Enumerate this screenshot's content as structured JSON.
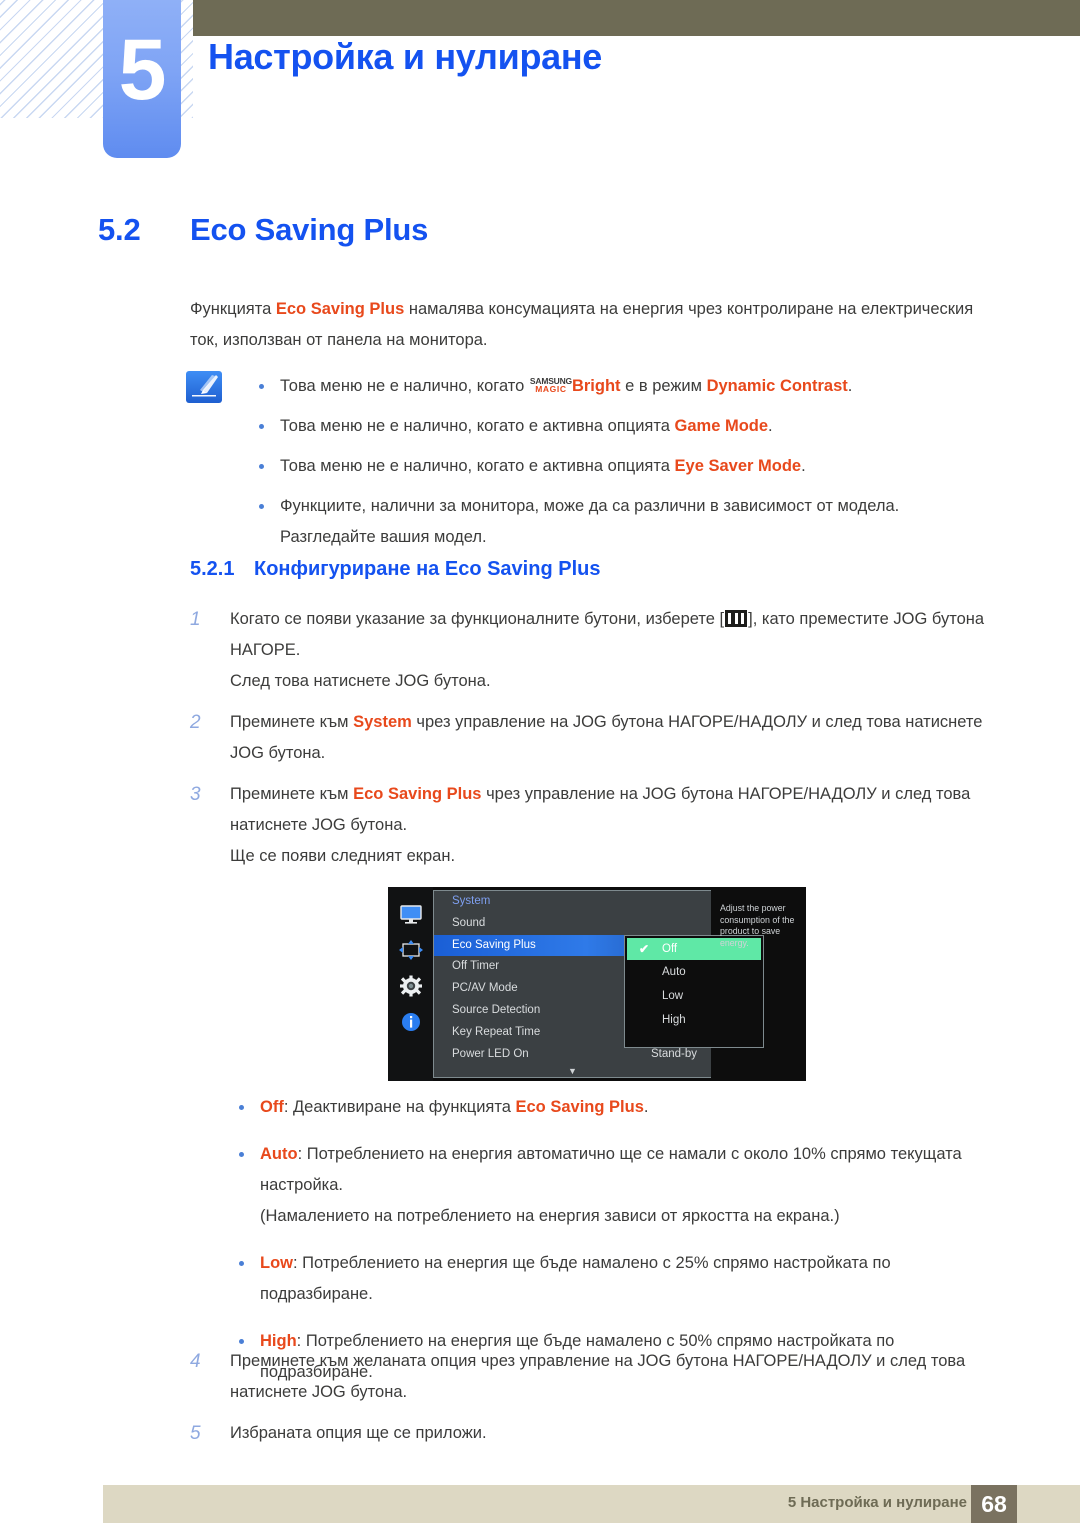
{
  "header": {
    "chapter_number": "5",
    "chapter_title": "Настройка и нулиране"
  },
  "section": {
    "number": "5.2",
    "title": "Eco Saving Plus"
  },
  "intro": {
    "before": "Функцията ",
    "highlight": "Eco Saving Plus",
    "after": " намалява консумацията на енергия чрез контролиране на електрическия ток, използван от панела на монитора."
  },
  "notes": {
    "icon": "note-pen-icon",
    "items": [
      {
        "t1": "Това меню не е налично, когато ",
        "magic_line1": "SAMSUNG",
        "magic_line2": "MAGIC",
        "magic_suffix": "Bright",
        "t2": " е в режим ",
        "hl2": "Dynamic Contrast",
        "t3": "."
      },
      {
        "t1": "Това меню не е налично, когато е активна опцията ",
        "hl2": "Game Mode",
        "t3": "."
      },
      {
        "t1": "Това меню не е налично, когато е активна опцията ",
        "hl2": "Eye Saver Mode",
        "t3": "."
      },
      {
        "t1": "Функциите, налични за монитора, може да са различни в зависимост от модела. Разгледайте вашия модел.",
        "hl2": "",
        "t3": ""
      }
    ]
  },
  "subsection": {
    "number": "5.2.1",
    "title": "Конфигуриране на Eco Saving Plus"
  },
  "steps": [
    {
      "num": "1",
      "t1": "Когато се появи указание за функционалните бутони, изберете [",
      "icon": "menu-bars-icon",
      "t2": "], като преместите JOG бутона НАГОРЕ.",
      "sub": "След това натиснете JOG бутона."
    },
    {
      "num": "2",
      "t1": "Преминете към ",
      "hl": "System",
      "t2": " чрез управление на JOG бутона НАГОРЕ/НАДОЛУ и след това натиснете JOG бутона.",
      "sub": ""
    },
    {
      "num": "3",
      "t1": "Преминете към ",
      "hl": "Eco Saving Plus",
      "t2": " чрез управление на JOG бутона НАГОРЕ/НАДОЛУ и след това натиснете JOG бутона.",
      "sub": "Ще се появи следният екран."
    }
  ],
  "steps_tail": [
    {
      "num": "4",
      "t1": "Преминете към желаната опция чрез управление на JOG бутона НАГОРЕ/НАДОЛУ и след това натиснете JOG бутона."
    },
    {
      "num": "5",
      "t1": "Избраната опция ще се приложи."
    }
  ],
  "osd": {
    "rail_icons": [
      "monitor-icon",
      "picture-size-icon",
      "gear-icon",
      "info-icon"
    ],
    "menu_title": "System",
    "menu_items": [
      {
        "label": "Sound",
        "value": ""
      },
      {
        "label": "Eco Saving Plus",
        "value": "",
        "active": true
      },
      {
        "label": "Off Timer",
        "value": ""
      },
      {
        "label": "PC/AV Mode",
        "value": ""
      },
      {
        "label": "Source Detection",
        "value": ""
      },
      {
        "label": "Key Repeat Time",
        "value": ""
      },
      {
        "label": "Power LED On",
        "value": "Stand-by"
      }
    ],
    "scroll_caret": "▼",
    "submenu": [
      {
        "label": "Off",
        "selected": true
      },
      {
        "label": "Auto",
        "selected": false
      },
      {
        "label": "Low",
        "selected": false
      },
      {
        "label": "High",
        "selected": false
      }
    ],
    "check_glyph": "✔",
    "description": "Adjust the power consumption of the product to save energy.",
    "colors": {
      "highlight_blue": "#2f7ae8",
      "selected_green": "#5fe8a6",
      "panel_gray": "#3b4043",
      "panel_black": "#0d0d0d"
    }
  },
  "options": [
    {
      "name": "Off",
      "t1": ": Деактивиране на функцията ",
      "hl": "Eco Saving Plus",
      "t2": ".",
      "sub": ""
    },
    {
      "name": "Auto",
      "t1": ": Потреблението на енергия автоматично ще се намали с около 10% спрямо текущата настройка.",
      "hl": "",
      "t2": "",
      "sub": "(Намалението на потреблението на енергия зависи от яркостта на екрана.)"
    },
    {
      "name": "Low",
      "t1": ": Потреблението на енергия ще бъде намалено с 25% спрямо настройката по подразбиране.",
      "hl": "",
      "t2": "",
      "sub": ""
    },
    {
      "name": "High",
      "t1": ": Потреблението на енергия ще бъде намалено с 50% спрямо настройката по подразбиране.",
      "hl": "",
      "t2": "",
      "sub": ""
    }
  ],
  "footer": {
    "text": "5 Настройка и нулиране",
    "page": "68"
  }
}
